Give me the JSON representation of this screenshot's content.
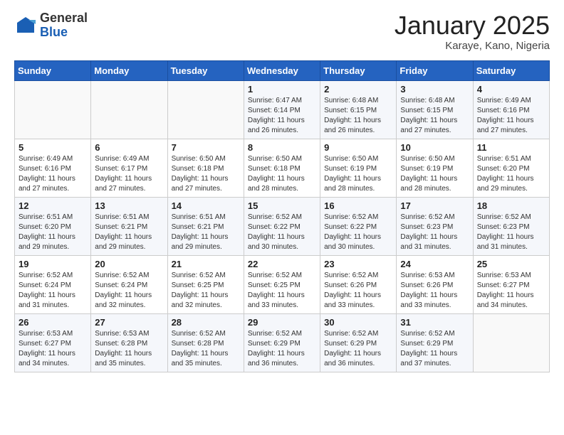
{
  "header": {
    "logo_general": "General",
    "logo_blue": "Blue",
    "title": "January 2025",
    "subtitle": "Karaye, Kano, Nigeria"
  },
  "weekdays": [
    "Sunday",
    "Monday",
    "Tuesday",
    "Wednesday",
    "Thursday",
    "Friday",
    "Saturday"
  ],
  "weeks": [
    [
      {
        "day": "",
        "info": ""
      },
      {
        "day": "",
        "info": ""
      },
      {
        "day": "",
        "info": ""
      },
      {
        "day": "1",
        "info": "Sunrise: 6:47 AM\nSunset: 6:14 PM\nDaylight: 11 hours and 26 minutes."
      },
      {
        "day": "2",
        "info": "Sunrise: 6:48 AM\nSunset: 6:15 PM\nDaylight: 11 hours and 26 minutes."
      },
      {
        "day": "3",
        "info": "Sunrise: 6:48 AM\nSunset: 6:15 PM\nDaylight: 11 hours and 27 minutes."
      },
      {
        "day": "4",
        "info": "Sunrise: 6:49 AM\nSunset: 6:16 PM\nDaylight: 11 hours and 27 minutes."
      }
    ],
    [
      {
        "day": "5",
        "info": "Sunrise: 6:49 AM\nSunset: 6:16 PM\nDaylight: 11 hours and 27 minutes."
      },
      {
        "day": "6",
        "info": "Sunrise: 6:49 AM\nSunset: 6:17 PM\nDaylight: 11 hours and 27 minutes."
      },
      {
        "day": "7",
        "info": "Sunrise: 6:50 AM\nSunset: 6:18 PM\nDaylight: 11 hours and 27 minutes."
      },
      {
        "day": "8",
        "info": "Sunrise: 6:50 AM\nSunset: 6:18 PM\nDaylight: 11 hours and 28 minutes."
      },
      {
        "day": "9",
        "info": "Sunrise: 6:50 AM\nSunset: 6:19 PM\nDaylight: 11 hours and 28 minutes."
      },
      {
        "day": "10",
        "info": "Sunrise: 6:50 AM\nSunset: 6:19 PM\nDaylight: 11 hours and 28 minutes."
      },
      {
        "day": "11",
        "info": "Sunrise: 6:51 AM\nSunset: 6:20 PM\nDaylight: 11 hours and 29 minutes."
      }
    ],
    [
      {
        "day": "12",
        "info": "Sunrise: 6:51 AM\nSunset: 6:20 PM\nDaylight: 11 hours and 29 minutes."
      },
      {
        "day": "13",
        "info": "Sunrise: 6:51 AM\nSunset: 6:21 PM\nDaylight: 11 hours and 29 minutes."
      },
      {
        "day": "14",
        "info": "Sunrise: 6:51 AM\nSunset: 6:21 PM\nDaylight: 11 hours and 29 minutes."
      },
      {
        "day": "15",
        "info": "Sunrise: 6:52 AM\nSunset: 6:22 PM\nDaylight: 11 hours and 30 minutes."
      },
      {
        "day": "16",
        "info": "Sunrise: 6:52 AM\nSunset: 6:22 PM\nDaylight: 11 hours and 30 minutes."
      },
      {
        "day": "17",
        "info": "Sunrise: 6:52 AM\nSunset: 6:23 PM\nDaylight: 11 hours and 31 minutes."
      },
      {
        "day": "18",
        "info": "Sunrise: 6:52 AM\nSunset: 6:23 PM\nDaylight: 11 hours and 31 minutes."
      }
    ],
    [
      {
        "day": "19",
        "info": "Sunrise: 6:52 AM\nSunset: 6:24 PM\nDaylight: 11 hours and 31 minutes."
      },
      {
        "day": "20",
        "info": "Sunrise: 6:52 AM\nSunset: 6:24 PM\nDaylight: 11 hours and 32 minutes."
      },
      {
        "day": "21",
        "info": "Sunrise: 6:52 AM\nSunset: 6:25 PM\nDaylight: 11 hours and 32 minutes."
      },
      {
        "day": "22",
        "info": "Sunrise: 6:52 AM\nSunset: 6:25 PM\nDaylight: 11 hours and 33 minutes."
      },
      {
        "day": "23",
        "info": "Sunrise: 6:52 AM\nSunset: 6:26 PM\nDaylight: 11 hours and 33 minutes."
      },
      {
        "day": "24",
        "info": "Sunrise: 6:53 AM\nSunset: 6:26 PM\nDaylight: 11 hours and 33 minutes."
      },
      {
        "day": "25",
        "info": "Sunrise: 6:53 AM\nSunset: 6:27 PM\nDaylight: 11 hours and 34 minutes."
      }
    ],
    [
      {
        "day": "26",
        "info": "Sunrise: 6:53 AM\nSunset: 6:27 PM\nDaylight: 11 hours and 34 minutes."
      },
      {
        "day": "27",
        "info": "Sunrise: 6:53 AM\nSunset: 6:28 PM\nDaylight: 11 hours and 35 minutes."
      },
      {
        "day": "28",
        "info": "Sunrise: 6:52 AM\nSunset: 6:28 PM\nDaylight: 11 hours and 35 minutes."
      },
      {
        "day": "29",
        "info": "Sunrise: 6:52 AM\nSunset: 6:29 PM\nDaylight: 11 hours and 36 minutes."
      },
      {
        "day": "30",
        "info": "Sunrise: 6:52 AM\nSunset: 6:29 PM\nDaylight: 11 hours and 36 minutes."
      },
      {
        "day": "31",
        "info": "Sunrise: 6:52 AM\nSunset: 6:29 PM\nDaylight: 11 hours and 37 minutes."
      },
      {
        "day": "",
        "info": ""
      }
    ]
  ]
}
